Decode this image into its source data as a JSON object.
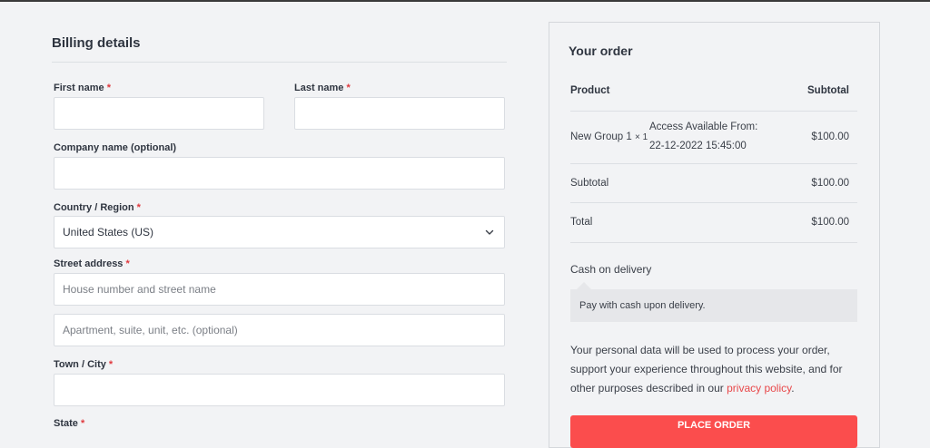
{
  "billing": {
    "title": "Billing details",
    "required_mark": "*",
    "first_name": {
      "label": "First name",
      "value": ""
    },
    "last_name": {
      "label": "Last name",
      "value": ""
    },
    "company": {
      "label": "Company name (optional)",
      "value": ""
    },
    "country": {
      "label": "Country / Region",
      "selected": "United States (US)"
    },
    "street": {
      "label": "Street address",
      "line1_placeholder": "House number and street name",
      "line2_placeholder": "Apartment, suite, unit, etc. (optional)"
    },
    "city": {
      "label": "Town / City",
      "value": ""
    },
    "state": {
      "label": "State"
    }
  },
  "order": {
    "title": "Your order",
    "col_product": "Product",
    "col_subtotal": "Subtotal",
    "item": {
      "name": "New Group 1",
      "qty": "× 1",
      "access_line1": "Access Available From:",
      "access_line2": "22-12-2022 15:45:00",
      "price": "$100.00"
    },
    "subtotal_label": "Subtotal",
    "subtotal_value": "$100.00",
    "total_label": "Total",
    "total_value": "$100.00",
    "payment_method": "Cash on delivery",
    "payment_desc": "Pay with cash upon delivery.",
    "privacy_text": "Your personal data will be used to process your order, support your experience throughout this website, and for other purposes described in our ",
    "privacy_link": "privacy policy",
    "privacy_end": ".",
    "place_order": "Place order"
  },
  "colors": {
    "accent": "#fb4d4d",
    "link": "#e8484a",
    "required": "#e0393e",
    "background": "#f2f3f5"
  },
  "icons": {
    "country_select": "chevron-down-icon"
  }
}
